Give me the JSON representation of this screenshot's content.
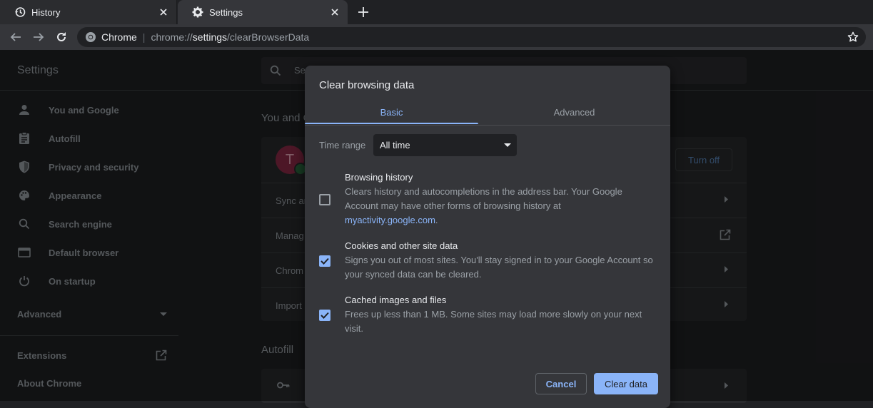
{
  "tabs": [
    {
      "label": "History",
      "icon": "history-icon"
    },
    {
      "label": "Settings",
      "icon": "gear-icon"
    }
  ],
  "toolbar": {
    "origin": "Chrome",
    "url_prefix": "chrome://",
    "url_host": "settings",
    "url_path": "/clearBrowserData"
  },
  "settings": {
    "title": "Settings",
    "search_placeholder": "Se",
    "nav": [
      {
        "label": "You and Google",
        "icon": "person-icon"
      },
      {
        "label": "Autofill",
        "icon": "clipboard-icon"
      },
      {
        "label": "Privacy and security",
        "icon": "shield-icon"
      },
      {
        "label": "Appearance",
        "icon": "palette-icon"
      },
      {
        "label": "Search engine",
        "icon": "search-icon"
      },
      {
        "label": "Default browser",
        "icon": "browser-icon"
      },
      {
        "label": "On startup",
        "icon": "power-icon"
      }
    ],
    "advanced_label": "Advanced",
    "extensions_label": "Extensions",
    "about_label": "About Chrome",
    "section_you_google": "You and G",
    "avatar_letter": "T",
    "turn_off_label": "Turn off",
    "rows": [
      "Sync ar",
      "Manag",
      "Chrom",
      "Import"
    ],
    "section_autofill": "Autofill"
  },
  "dialog": {
    "title": "Clear browsing data",
    "tab_basic": "Basic",
    "tab_advanced": "Advanced",
    "time_range_label": "Time range",
    "time_range_value": "All time",
    "items": [
      {
        "title": "Browsing history",
        "desc_lines": [
          "Clears history and autocompletions in the address bar. Your Google",
          "Account may have other forms of browsing history at"
        ],
        "link": "myactivity.google.com",
        "link_suffix": ".",
        "checked": false
      },
      {
        "title": "Cookies and other site data",
        "desc_lines": [
          "Signs you out of most sites. You'll stay signed in to your Google Account so",
          "your synced data can be cleared."
        ],
        "checked": true
      },
      {
        "title": "Cached images and files",
        "desc_lines": [
          "Frees up less than 1 MB. Some sites may load more slowly on your next",
          "visit."
        ],
        "checked": true
      }
    ],
    "cancel_label": "Cancel",
    "clear_label": "Clear data"
  },
  "colors": {
    "accent": "#8ab4f8",
    "dialog_bg": "#35363a",
    "page_bg": "#202124"
  }
}
